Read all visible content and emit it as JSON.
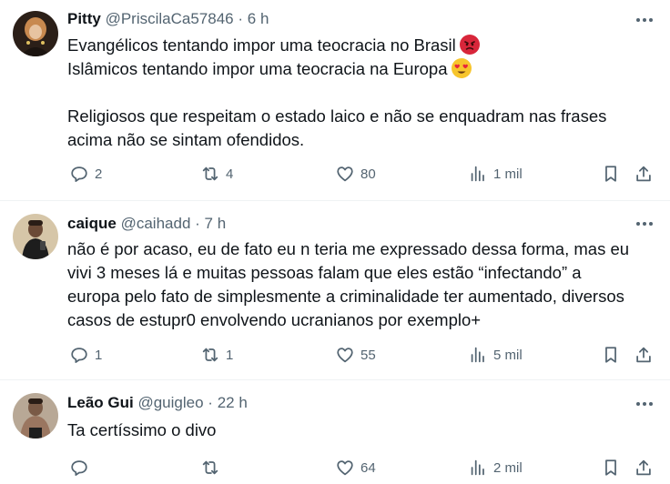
{
  "posts": [
    {
      "name": "Pitty",
      "handle": "@PriscilaCa57846",
      "sep": "·",
      "time": "6 h",
      "lines": [
        "Evangélicos tentando impor uma teocracia no Brasil",
        "Islâmicos tentando impor uma teocracia na Europa",
        "",
        "Religiosos que respeitam o estado laico e não se enquadram nas frases",
        "acima não se sintam ofendidos."
      ],
      "line_emojis": [
        "angry-face-emoji",
        "heart-eyes-emoji",
        "",
        "",
        ""
      ],
      "replies": "2",
      "reposts": "4",
      "likes": "80",
      "views": "1 mil",
      "avatar_color": "#3a2a1f"
    },
    {
      "name": "caique",
      "handle": "@caihadd",
      "sep": "·",
      "time": "7 h",
      "lines": [
        "não é por acaso, eu de fato eu n teria me expressado dessa forma, mas eu",
        "vivi 3 meses lá e muitas pessoas falam que eles estão “infectando” a",
        "europa pelo fato de simplesmente a criminalidade ter aumentado, diversos",
        "casos de estupr0 envolvendo ucranianos por exemplo+"
      ],
      "replies": "1",
      "reposts": "1",
      "likes": "55",
      "views": "5 mil",
      "avatar_color": "#c9b79a"
    },
    {
      "name": "Leão Gui",
      "handle": "@guigleo",
      "sep": "·",
      "time": "22 h",
      "lines": [
        "Ta certíssimo o divo"
      ],
      "replies": "",
      "reposts": "",
      "likes": "64",
      "views": "2 mil",
      "avatar_color": "#8a7565"
    }
  ],
  "icons": {
    "reply": "reply-icon",
    "repost": "repost-icon",
    "like": "like-icon",
    "views": "views-icon",
    "bookmark": "bookmark-icon",
    "share": "share-icon",
    "more": "more-icon"
  },
  "colors": {
    "text": "#0f1419",
    "secondary": "#536471",
    "divider": "#eff3f4",
    "angry_emoji": "#d8263a",
    "heart_eyes_emoji": "#f7c52c"
  }
}
